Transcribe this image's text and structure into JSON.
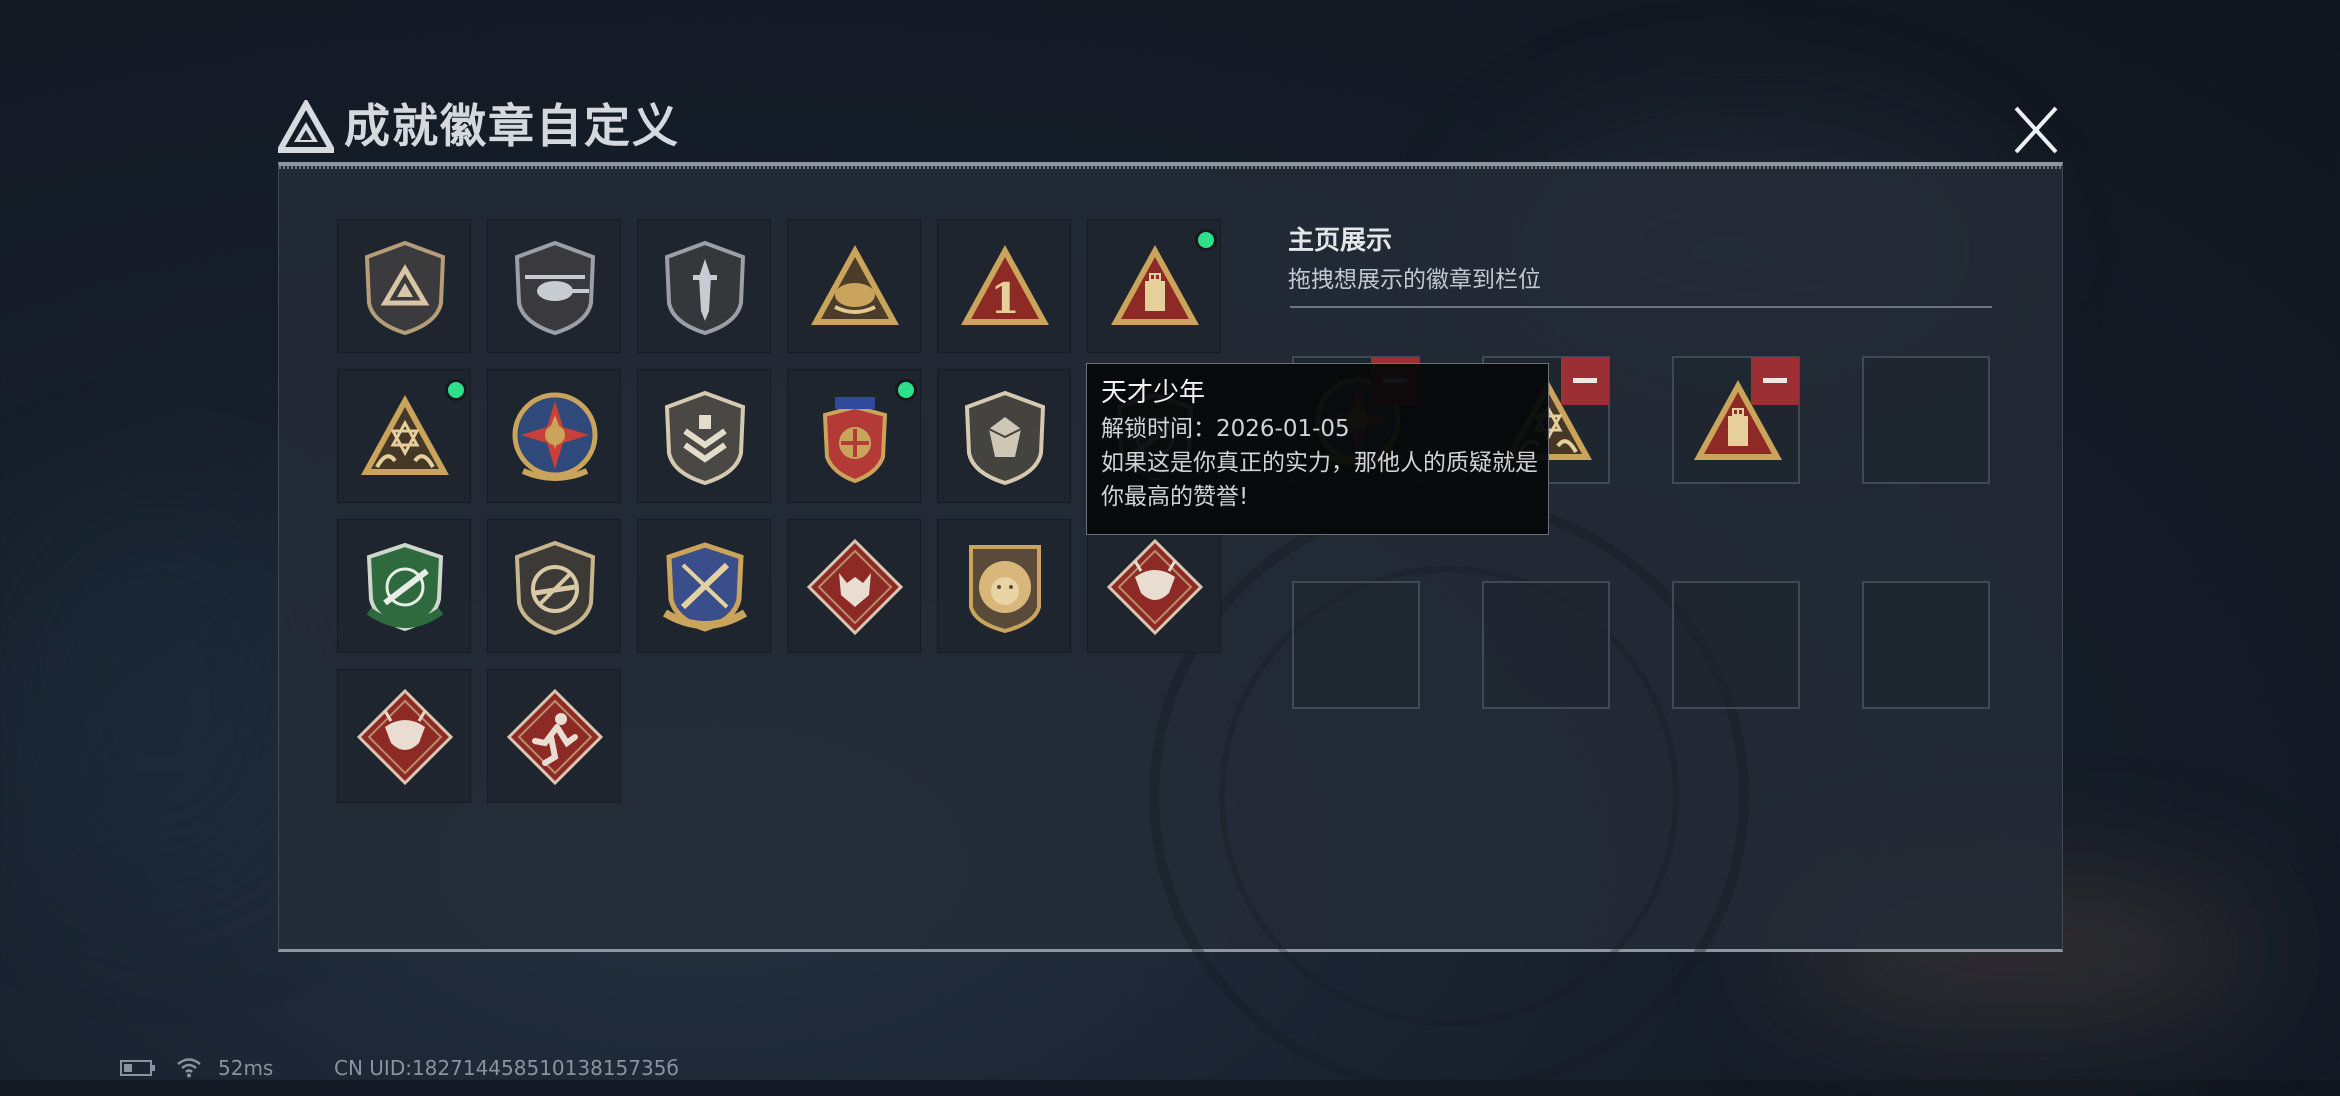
{
  "header": {
    "title": "成就徽章自定义"
  },
  "showcase": {
    "title": "主页展示",
    "hint": "拖拽想展示的徽章到栏位"
  },
  "tooltip": {
    "name": "天才少年",
    "unlock_time": "解锁时间：2026-01-05",
    "description": "如果这是你真正的实力，那他人的质疑就是你最高的赞誉!"
  },
  "badges": [
    {
      "icon": "delta-shield-badge-icon",
      "new": false
    },
    {
      "icon": "helicopter-shield-badge-icon",
      "new": false
    },
    {
      "icon": "dagger-shield-badge-icon",
      "new": false
    },
    {
      "icon": "eagle-triangle-badge-icon",
      "new": false
    },
    {
      "icon": "number-one-triangle-badge-icon",
      "new": false
    },
    {
      "icon": "usb-triangle-badge-icon",
      "new": true
    },
    {
      "icon": "hexagram-hands-triangle-badge-icon",
      "new": true
    },
    {
      "icon": "star-compass-badge-icon",
      "new": false
    },
    {
      "icon": "chevron-shield-badge-icon",
      "new": false
    },
    {
      "icon": "wings-laurel-badge-icon",
      "new": true
    },
    {
      "icon": "gem-shield-badge-icon",
      "new": false
    },
    {
      "icon": "green-crosshair-rifle-badge-icon",
      "new": false
    },
    {
      "icon": "green-crosshair-rifle-badge-icon",
      "new": false
    },
    {
      "icon": "no-gun-shield-badge-icon",
      "new": false
    },
    {
      "icon": "blue-crossed-weapons-badge-icon",
      "new": false
    },
    {
      "icon": "wolf-diamond-badge-icon",
      "new": false
    },
    {
      "icon": "lion-shield-badge-icon",
      "new": false
    },
    {
      "icon": "dragon-diamond-badge-icon",
      "new": false
    },
    {
      "icon": "dragon-diamond-badge-icon",
      "new": false
    },
    {
      "icon": "runner-diamond-badge-icon",
      "new": false
    }
  ],
  "slots": [
    {
      "icon": "star-compass-badge-icon",
      "filled": true
    },
    {
      "icon": "hexagram-hands-triangle-badge-icon",
      "filled": true
    },
    {
      "icon": "usb-triangle-badge-icon",
      "filled": true
    },
    {
      "icon": "",
      "filled": false
    },
    {
      "icon": "",
      "filled": false
    },
    {
      "icon": "",
      "filled": false
    },
    {
      "icon": "",
      "filled": false
    },
    {
      "icon": "",
      "filled": false
    }
  ],
  "colors": {
    "new_indicator": "#2fe08a",
    "remove_button": "#9c2f33",
    "badge_gold": "#c9a45a",
    "badge_red": "#8e2a25"
  },
  "status_bar": {
    "latency": "52ms",
    "uid": "CN UID:18271445851013815735б"
  }
}
